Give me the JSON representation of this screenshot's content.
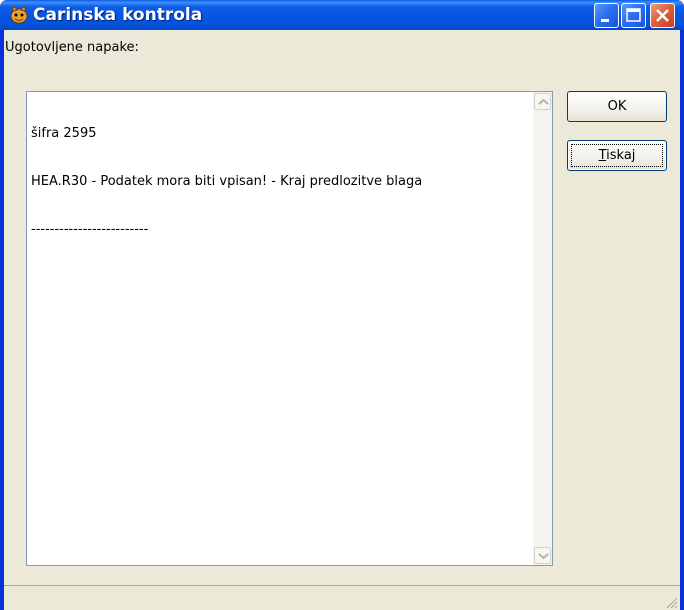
{
  "window": {
    "title": "Carinska kontrola",
    "icon": "cat-app-icon",
    "controls": {
      "minimize": "minimize-icon",
      "maximize": "maximize-icon",
      "close": "close-icon"
    }
  },
  "errors": {
    "label": "Ugotovljene napake:",
    "lines": [
      "šifra 2595",
      "HEA.R30 - Podatek mora biti vpisan! - Kraj predlozitve blaga",
      "-------------------------"
    ]
  },
  "buttons": {
    "ok_label": "OK",
    "print_label": "Tiskaj"
  },
  "colors": {
    "titlebar": "#0655e0",
    "client": "#ece9d8",
    "memo_border": "#7f9db9",
    "close_button": "#e0603a"
  }
}
